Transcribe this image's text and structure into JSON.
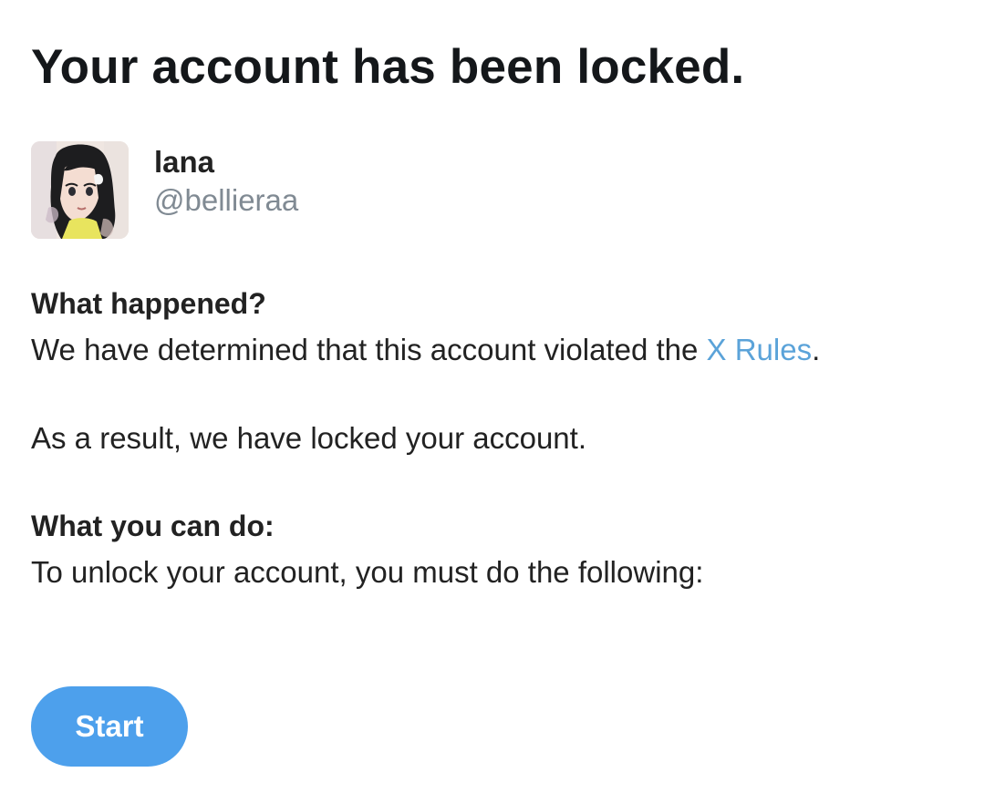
{
  "page": {
    "title": "Your account has been locked."
  },
  "profile": {
    "avatar_icon": "user-avatar",
    "display_name": "lana",
    "handle": "@bellieraa"
  },
  "what_happened": {
    "heading": "What happened?",
    "text_before_link": "We have determined that this account violated the ",
    "link_label": "X Rules",
    "text_after_link": ".",
    "result_text": "As a result, we have locked your account."
  },
  "what_you_can_do": {
    "heading": "What you can do:",
    "text": "To unlock your account, you must do the following:"
  },
  "actions": {
    "start_label": "Start"
  },
  "colors": {
    "link": "#5ba3d9",
    "button": "#4da0ec",
    "handle": "#808a93",
    "text": "#222222"
  }
}
